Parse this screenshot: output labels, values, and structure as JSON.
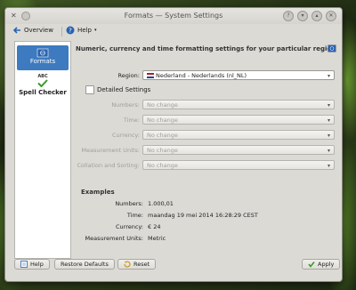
{
  "window": {
    "title": "Formats — System Settings"
  },
  "toolbar": {
    "overview_label": "Overview",
    "help_label": "Help"
  },
  "sidebar": {
    "items": [
      {
        "label": "Formats"
      },
      {
        "label": "Spell Checker",
        "icon_text": "ABC"
      }
    ]
  },
  "main": {
    "heading": "Numeric, currency and time formatting settings for your particular region",
    "region_label": "Region:",
    "region_value": "Nederland - Nederlands (nl_NL)",
    "detailed_label": "Detailed Settings",
    "detail_rows": [
      {
        "label": "Numbers:",
        "value": "No change"
      },
      {
        "label": "Time:",
        "value": "No change"
      },
      {
        "label": "Currency:",
        "value": "No change"
      },
      {
        "label": "Measurement Units:",
        "value": "No change"
      },
      {
        "label": "Collation and Sorting:",
        "value": "No change"
      }
    ],
    "examples_heading": "Examples",
    "examples": [
      {
        "label": "Numbers:",
        "value": "1.000,01"
      },
      {
        "label": "Time:",
        "value": "maandag 19 mei 2014 16:28:29 CEST"
      },
      {
        "label": "Currency:",
        "value": "€ 24"
      },
      {
        "label": "Measurement Units:",
        "value": "Metric"
      }
    ]
  },
  "buttons": {
    "help": "Help",
    "restore": "Restore Defaults",
    "reset": "Reset",
    "apply": "Apply"
  },
  "colors": {
    "selection": "#3d7abf",
    "window_bg": "#dcdad5"
  }
}
